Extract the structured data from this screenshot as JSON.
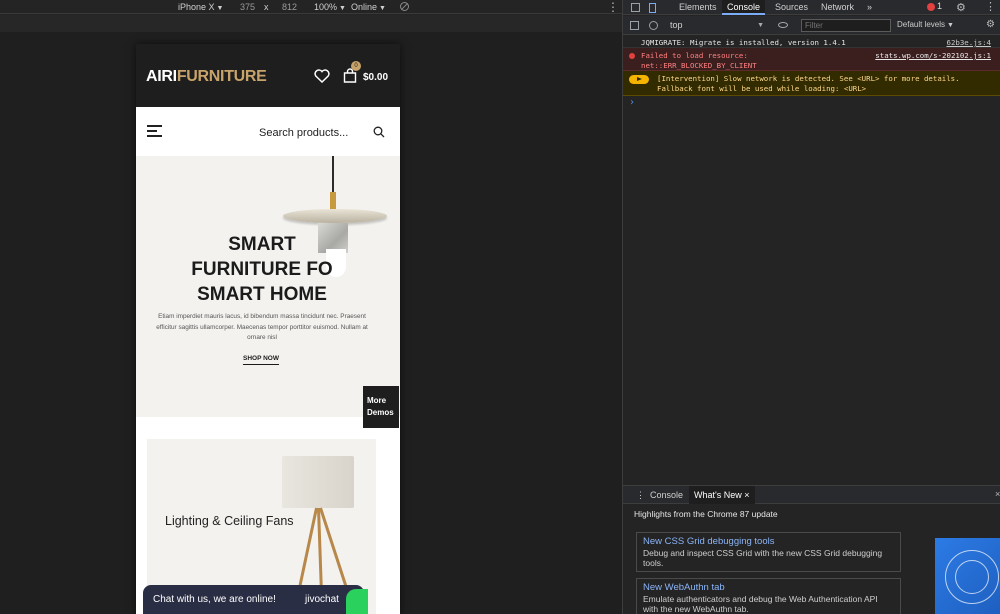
{
  "device_toolbar": {
    "device": "iPhone X",
    "width": "375",
    "times": "x",
    "height": "812",
    "zoom": "100%",
    "network": "Online",
    "more": "⋮"
  },
  "site": {
    "logo_primary": "AIRI",
    "logo_accent": "FURNITURE",
    "cart_count": "0",
    "cart_total": "$0.00",
    "search_placeholder": "Search products...",
    "hero_title_lines": [
      "SMART",
      "FURNITURE FO",
      "SMART HOME"
    ],
    "hero_description": "Etiam imperdiet mauris lacus, id bibendum massa tincidunt nec. Praesent efficitur sagittis ullamcorper. Maecenas tempor porttitor euismod. Nullam at ornare nisl",
    "shop_now": "SHOP NOW",
    "more_demos": "More Demos",
    "category_title": "Lighting & Ceiling Fans",
    "chat_text": "Chat with us, we are online!",
    "chat_brand": "jivochat",
    "accent_color": "#c9a46a"
  },
  "devtools": {
    "tabs": [
      "Elements",
      "Console",
      "Sources",
      "Network"
    ],
    "active_tab": "Console",
    "more_tabs": "»",
    "error_count": "1",
    "context": "top",
    "filter_placeholder": "Filter",
    "levels": "Default levels",
    "messages": [
      {
        "level": "info",
        "text": "JQMIGRATE: Migrate is installed, version 1.4.1",
        "source": "62b3e.js:4"
      },
      {
        "level": "error",
        "text": "Failed to load resource:\nnet::ERR_BLOCKED_BY_CLIENT",
        "source": "stats.wp.com/s-202102.js:1"
      },
      {
        "level": "warning",
        "text": "[Intervention] Slow network is detected. See <URL> for more details.\nFallback font will be used while loading: <URL>",
        "source": ""
      }
    ],
    "prompt": "›",
    "drawer_tabs": [
      "Console",
      "What's New"
    ],
    "drawer_active": "What's New",
    "drawer_tab_close": "×",
    "drawer_close": "×",
    "whats_new_header": "Highlights from the Chrome 87 update",
    "whats_new_items": [
      {
        "title": "New CSS Grid debugging tools",
        "description": "Debug and inspect CSS Grid with the new CSS Grid debugging tools."
      },
      {
        "title": "New WebAuthn tab",
        "description": "Emulate authenticators and debug the Web Authentication API with the new WebAuthn tab."
      }
    ]
  }
}
